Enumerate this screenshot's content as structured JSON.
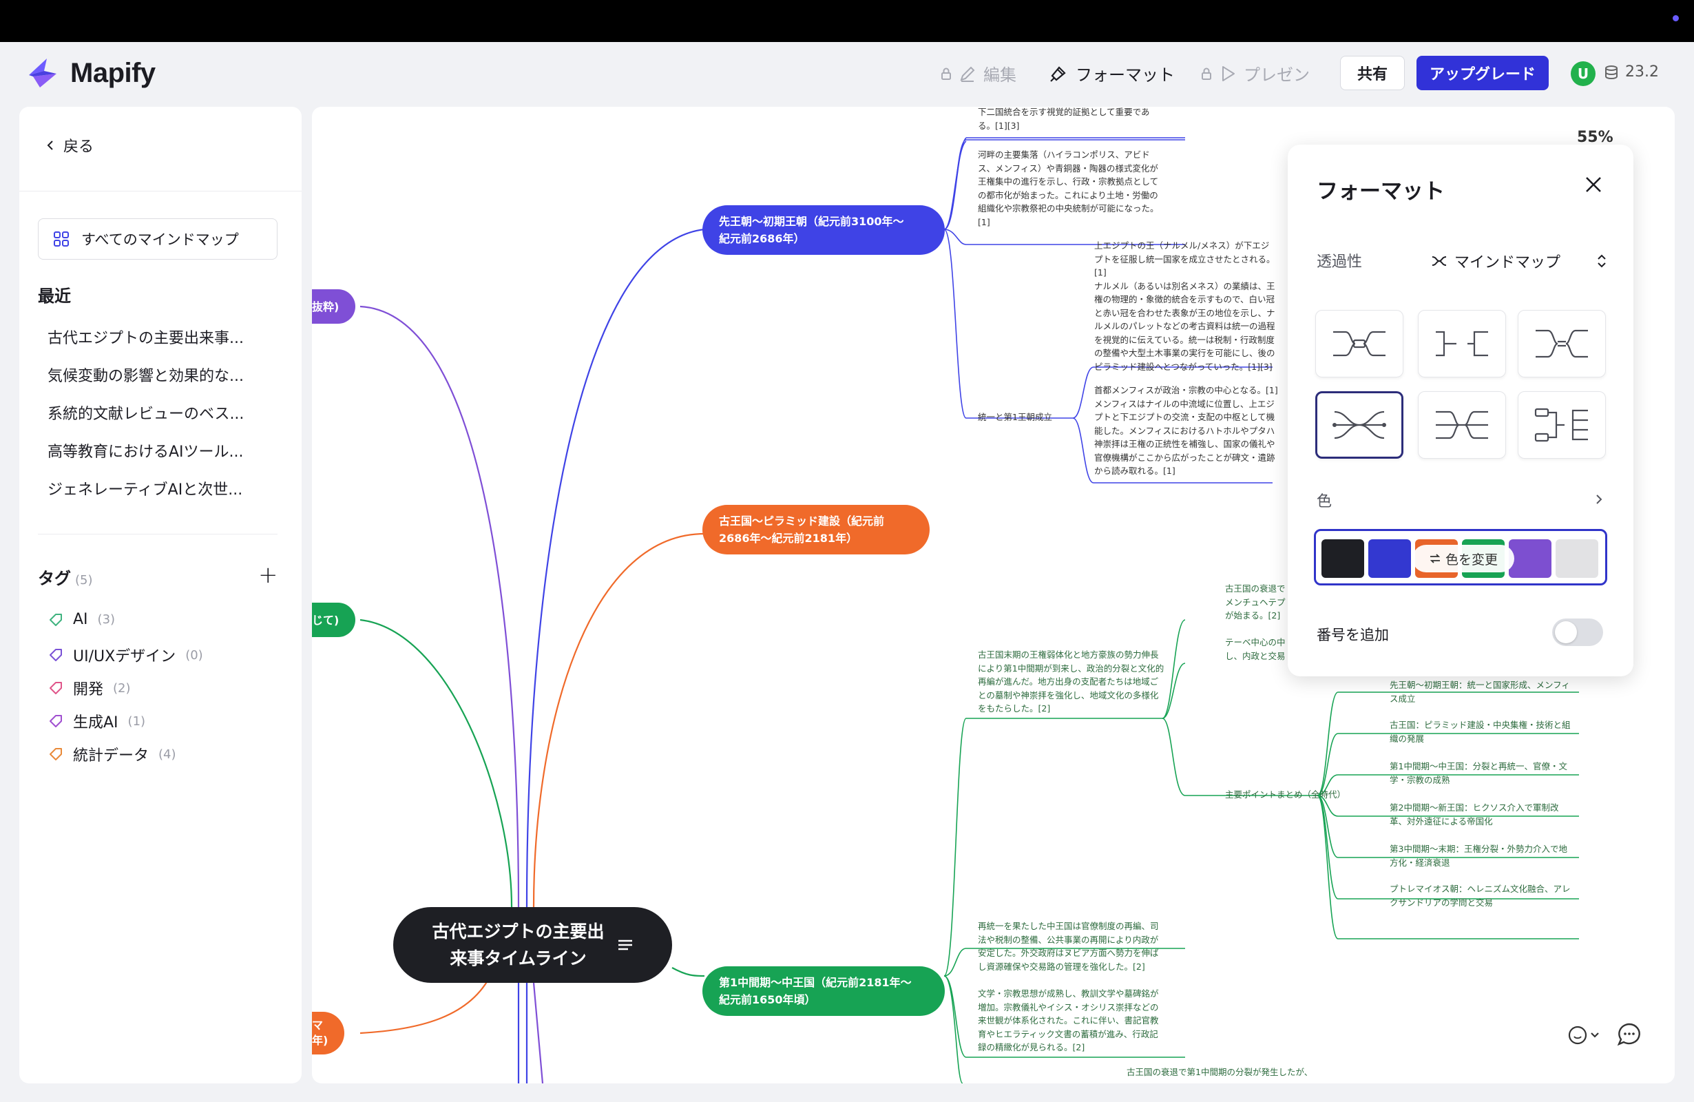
{
  "app": {
    "name": "Mapify"
  },
  "toolbar": {
    "edit_label": "編集",
    "format_label": "フォーマット",
    "present_label": "プレゼン",
    "share_label": "共有",
    "upgrade_label": "アップグレード",
    "avatar_initial": "U",
    "credits": "23.2"
  },
  "sidebar": {
    "back_label": "戻る",
    "all_maps_label": "すべてのマインドマップ",
    "recent_title": "最近",
    "recent": [
      "古代エジプトの主要出来事...",
      "気候変動の影響と効果的な...",
      "系統的文献レビューのベス...",
      "高等教育におけるAIツール...",
      "ジェネレーティブAIと次世..."
    ],
    "tags_title": "タグ",
    "tags_count": "(5)",
    "tags": [
      {
        "name": "AI",
        "count": "(3)",
        "color": "#3fb37f"
      },
      {
        "name": "UI/UXデザイン",
        "count": "(0)",
        "color": "#7a52d6"
      },
      {
        "name": "開発",
        "count": "(2)",
        "color": "#e0558a"
      },
      {
        "name": "生成AI",
        "count": "(1)",
        "color": "#a04fd0"
      },
      {
        "name": "統計データ",
        "count": "(4)",
        "color": "#e98a3a"
      }
    ]
  },
  "mindmap": {
    "zoom": "55%",
    "central": "古代エジプトの主要出\n来事タイムライン",
    "branches": [
      {
        "label": "先王朝〜初期王朝（紀元前3100年〜\n紀元前2686年）",
        "color": "#3f43e6"
      },
      {
        "label": "古王国〜ピラミッド建設（紀元前\n2686年〜紀元前2181年）",
        "color": "#f06a2a"
      },
      {
        "label": "第1中間期〜中王国（紀元前2181年〜\n紀元前1650年頃）",
        "color": "#17a354"
      }
    ],
    "partial_branches": [
      "抜粋)",
      "じて)",
      "マ\n年)"
    ],
    "subtopic_unification": "統一と第1王朝成立",
    "subtopic_summary": "主要ポイントまとめ（全時代）",
    "notes": {
      "n1": "下二国統合を示す視覚的証拠として重要であ\nる。[1][3]",
      "n2": "河畔の主要集落（ハイラコンポリス、アビド\nス、メンフィス）や青銅器・陶器の様式変化が\n王権集中の進行を示し、行政・宗教拠点として\nの都市化が始まった。これにより土地・労働の\n組織化や宗教祭祀の中央統制が可能になった。\n[1]",
      "n3": "上エジプトの王（ナルメル/メネス）が下エジ\nプトを征服し統一国家を成立させたとされる。\n[1]\nナルメル（あるいは別名メネス）の業績は、王\n権の物理的・象徴的統合を示すもので、白い冠\nと赤い冠を合わせた表象が王の地位を示し、ナ\nルメルのパレットなどの考古資料は統一の過程\nを視覚的に伝えている。統一は税制・行政制度\nの整備や大型土木事業の実行を可能にし、後の\nピラミッド建設へとつながっていった。[1][3]",
      "n4": "首都メンフィスが政治・宗教の中心となる。[1]\nメンフィスはナイルの中流域に位置し、上エジ\nプトと下エジプトの交流・支配の中枢として機\n能した。メンフィスにおけるハトホルやプタハ\n神崇拝は王権の正統性を補強し、国家の儀礼や\n官僚機構がここから広がったことが碑文・遺跡\nから読み取れる。[1]",
      "n5": "古王国末期の王権弱体化と地方豪族の勢力伸長\nにより第1中間期が到来し、政治的分裂と文化的\n再編が進んだ。地方出身の支配者たちは地域ご\nとの墓制や神崇拝を強化し、地域文化の多様化\nをもたらした。[2]",
      "n6": "古王国の衰退で\nメンチュヘテプ\nが始まる。[2]",
      "n7": "テーベ中心の中\nし、内政と交易",
      "n8": "再統一を果たした中王国は官僚制度の再編、司\n法や税制の整備、公共事業の再開により内政が\n安定した。外交政府はヌビア方面へ勢力を伸ば\nし資源確保や交易路の管理を強化した。[2]",
      "n9": "文学・宗教思想が成熟し、教訓文学や墓碑銘が\n増加。宗教儀礼やイシス・オシリス崇拝などの\n来世観が体系化された。これに伴い、書記官教\n育やヒエラティック文書の蓄積が進み、行政記\n録の精緻化が見られる。[2]",
      "n10": "古王国の衰退で第1中間期の分裂が発生したが、"
    },
    "summary_items": [
      "先王朝〜初期王朝：統一と国家形成、メンフィ\nス成立",
      "古王国：ピラミッド建設・中央集権・技術と組\n織の発展",
      "第1中間期〜中王国：分裂と再統一、官僚・文\n学・宗教の成熟",
      "第2中間期〜新王国：ヒクソス介入で軍制改\n革、対外遠征による帝国化",
      "第3中間期〜末期：王権分裂・外勢力介入で地\n方化・経済衰退",
      "プトレマイオス朝：ヘレニズム文化融合、アレ\nクサンドリアの学問と交易"
    ]
  },
  "format_panel": {
    "title": "フォーマット",
    "transparency_label": "透過性",
    "mode_label": "マインドマップ",
    "color_label": "色",
    "change_color_label": "色を変更",
    "numbering_label": "番号を追加",
    "numbering_on": false,
    "selected_layout_index": 3,
    "swatches": [
      "#1e1f24",
      "#3338d0",
      "#e8642a",
      "#17a354",
      "#7d4fd0",
      "#e2e2e4"
    ]
  }
}
